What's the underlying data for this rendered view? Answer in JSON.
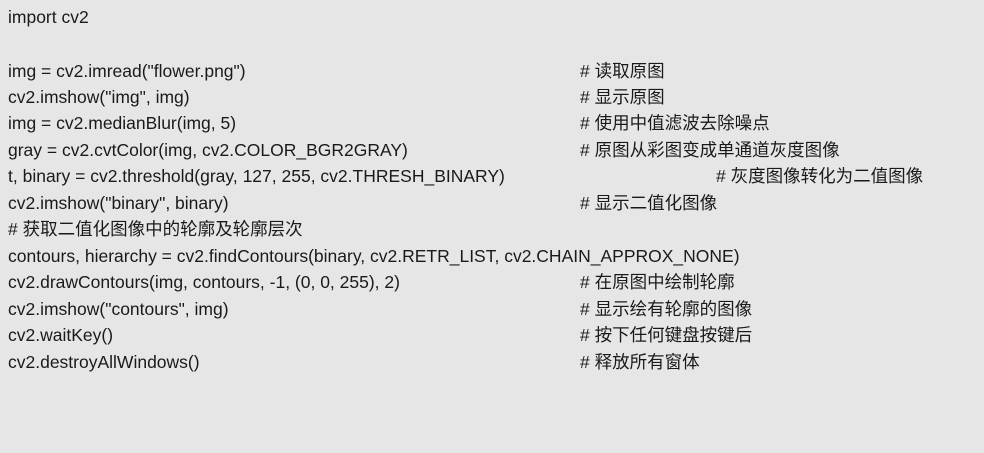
{
  "lines": [
    {
      "code": "import cv2",
      "comment": ""
    },
    {
      "code": "",
      "comment": ""
    },
    {
      "code": "img = cv2.imread(\"flower.png\")",
      "comment": "# 读取原图"
    },
    {
      "code": "cv2.imshow(\"img\", img)",
      "comment": "# 显示原图"
    },
    {
      "code": "img = cv2.medianBlur(img, 5)",
      "comment": "# 使用中值滤波去除噪点"
    },
    {
      "code": "gray = cv2.cvtColor(img, cv2.COLOR_BGR2GRAY)",
      "comment": "# 原图从彩图变成单通道灰度图像"
    },
    {
      "code": "t, binary = cv2.threshold(gray, 127, 255, cv2.THRESH_BINARY)",
      "comment": "# 灰度图像转化为二值图像"
    },
    {
      "code": "cv2.imshow(\"binary\", binary)",
      "comment": "# 显示二值化图像"
    },
    {
      "code": "# 获取二值化图像中的轮廓及轮廓层次",
      "comment": ""
    },
    {
      "code": "contours, hierarchy = cv2.findContours(binary, cv2.RETR_LIST, cv2.CHAIN_APPROX_NONE)",
      "comment": ""
    },
    {
      "code": "cv2.drawContours(img, contours, -1, (0, 0, 255), 2)",
      "comment": "# 在原图中绘制轮廓"
    },
    {
      "code": "cv2.imshow(\"contours\", img)",
      "comment": "# 显示绘有轮廓的图像"
    },
    {
      "code": "cv2.waitKey()",
      "comment": "# 按下任何键盘按键后"
    },
    {
      "code": "cv2.destroyAllWindows()",
      "comment": "# 释放所有窗体"
    }
  ]
}
